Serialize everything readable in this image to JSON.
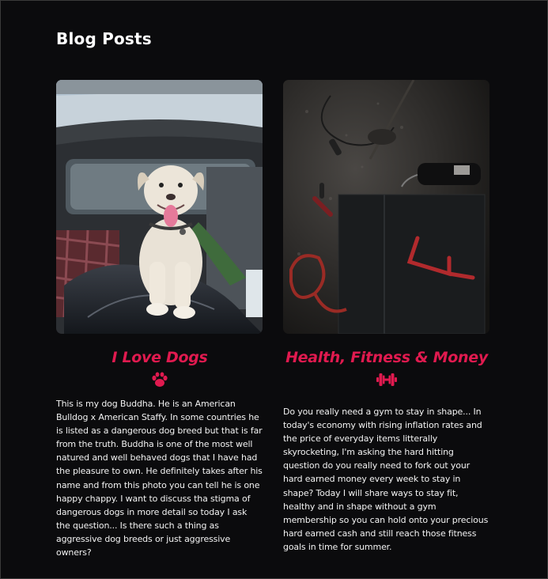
{
  "page": {
    "title": "Blog Posts"
  },
  "posts": [
    {
      "title": "I Love Dogs",
      "icon": "paw-icon",
      "body": "This is my dog Buddha. He is an American Bulldog x American Staffy. In some countries he is listed as a dangerous dog breed but that is far from the truth. Buddha is one of the most well natured and well behaved dogs that I have had the pleasure to own. He definitely takes after his name and from this photo you can tell he is one happy chappy. I want to discuss tha stigma of dangerous dogs in more detail so today I ask the question... Is there such a thing as aggressive dog breeds or just aggressive owners?"
    },
    {
      "title": "Health, Fitness & Money",
      "icon": "dumbbell-icon",
      "body": "Do you really need a gym to stay in shape... In today's economy with rising inflation rates and the price of everyday items litterally skyrocketing, I'm asking the hard hitting question do you really need to fork out your hard earned money every week to stay in shape? Today I will share ways to stay fit, healthy and in shape without a gym membership so you can hold onto your precious hard earned cash and still reach those fitness goals in time for summer."
    }
  ],
  "colors": {
    "accent": "#e01a4f",
    "background": "#0b0b0d",
    "text": "#f2f2f2"
  }
}
